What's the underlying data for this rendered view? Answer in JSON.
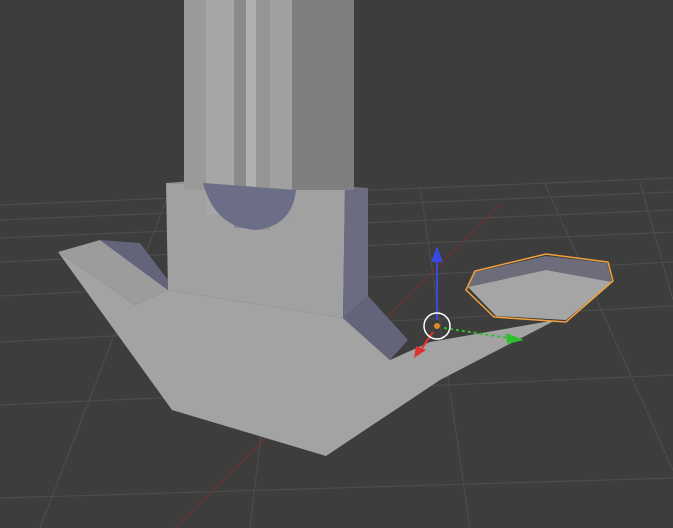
{
  "app": {
    "name": "3D Viewport"
  },
  "viewport": {
    "background_color": "#3d3d3d",
    "grid_color": "#4e4e4e",
    "x_axis_line_color": "#7a2f2f",
    "selection_outline_color": "#f5a13a",
    "gizmo": {
      "x_axis_color": "#e0302f",
      "y_axis_color": "#2fbf2f",
      "z_axis_color": "#3a47e0",
      "origin_color": "#e08a2a",
      "cursor_ring_color": "#ffffff"
    },
    "objects": [
      {
        "name": "pillar",
        "color": "#8c8c8c",
        "selected": false
      },
      {
        "name": "base",
        "color": "#a0a0a0",
        "selected": false
      },
      {
        "name": "flat-piece",
        "color": "#a0a0a0",
        "selected": true
      }
    ]
  }
}
